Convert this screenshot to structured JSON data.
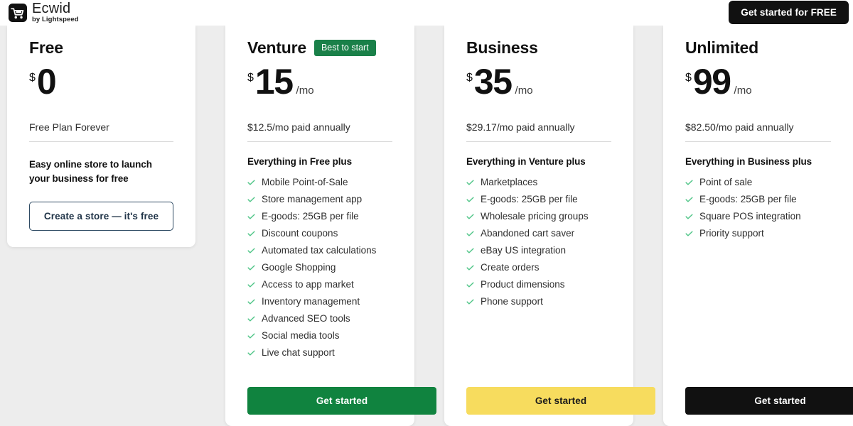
{
  "header": {
    "logo_name": "Ecwid",
    "logo_sub": "by Lightspeed",
    "logo_icon": "shopping-cart-icon",
    "cta_label": "Get started for FREE"
  },
  "colors": {
    "page_background": "#ededed",
    "card_background": "#ffffff",
    "badge_green": "#1a8049",
    "button_green": "#10833f",
    "button_yellow": "#f7dc5e",
    "button_black": "#111111",
    "check_green": "#4fc587",
    "outline_border": "#2e4a63"
  },
  "plans": [
    {
      "name": "Free",
      "badge": "",
      "currency": "$",
      "amount": "0",
      "per": "",
      "annual": "Free Plan Forever",
      "includes_title": "",
      "description": "Easy online store to launch your business for free",
      "features": [],
      "cta_label": "Create a store — it's free",
      "cta_style": "outline"
    },
    {
      "name": "Venture",
      "badge": "Best to start",
      "currency": "$",
      "amount": "15",
      "per": "/mo",
      "annual": "$12.5/mo paid annually",
      "includes_title": "Everything in Free plus",
      "description": "",
      "features": [
        "Mobile Point-of-Sale",
        "Store management app",
        "E-goods: 25GB per file",
        "Discount coupons",
        "Automated tax calculations",
        "Google Shopping",
        "Access to app market",
        "Inventory management",
        "Advanced SEO tools",
        "Social media tools",
        "Live chat support"
      ],
      "cta_label": "Get started",
      "cta_style": "green"
    },
    {
      "name": "Business",
      "badge": "",
      "currency": "$",
      "amount": "35",
      "per": "/mo",
      "annual": "$29.17/mo paid annually",
      "includes_title": "Everything in Venture plus",
      "description": "",
      "features": [
        "Marketplaces",
        "E-goods: 25GB per file",
        "Wholesale pricing groups",
        "Abandoned cart saver",
        "eBay US integration",
        "Create orders",
        "Product dimensions",
        "Phone support"
      ],
      "cta_label": "Get started",
      "cta_style": "yellow"
    },
    {
      "name": "Unlimited",
      "badge": "",
      "currency": "$",
      "amount": "99",
      "per": "/mo",
      "annual": "$82.50/mo paid annually",
      "includes_title": "Everything in Business plus",
      "description": "",
      "features": [
        "Point of sale",
        "E-goods: 25GB per file",
        "Square POS integration",
        "Priority support"
      ],
      "cta_label": "Get started",
      "cta_style": "black"
    }
  ]
}
